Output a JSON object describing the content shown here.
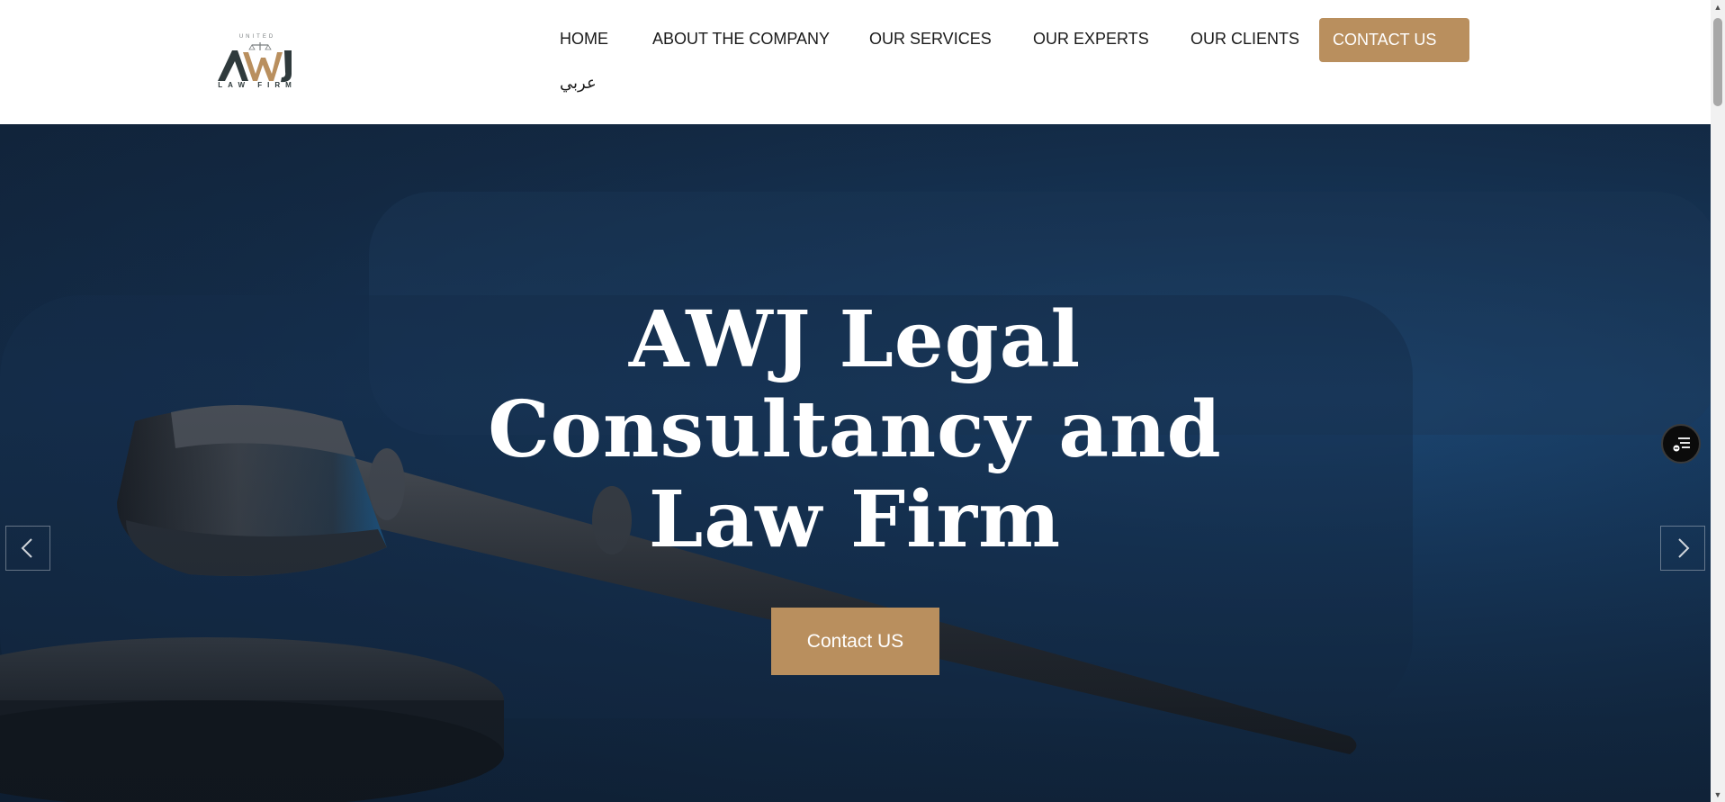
{
  "brand": {
    "top_text": "UNITED",
    "mark": "AWJ",
    "bottom_text": "LAW FIRM",
    "colors": {
      "dark": "#2f3a3c",
      "gold": "#b98f5e"
    }
  },
  "nav": {
    "items": [
      {
        "label": "HOME"
      },
      {
        "label": "ABOUT THE COMPANY"
      },
      {
        "label": "OUR SERVICES"
      },
      {
        "label": "OUR EXPERTS"
      },
      {
        "label": "OUR CLIENTS"
      }
    ],
    "cta_label": "CONTACT US",
    "language_label": "عربي"
  },
  "hero": {
    "title_lines": [
      "AWJ Legal",
      "Consultancy and",
      "Law Firm"
    ],
    "button_label": "Contact US",
    "prev_icon": "chevron-left-icon",
    "next_icon": "chevron-right-icon",
    "float_icon": "accessibility-menu-icon"
  },
  "colors": {
    "accent": "#b98f5e",
    "hero_bg": "#173a60",
    "nav_text": "#1a1a1a"
  }
}
